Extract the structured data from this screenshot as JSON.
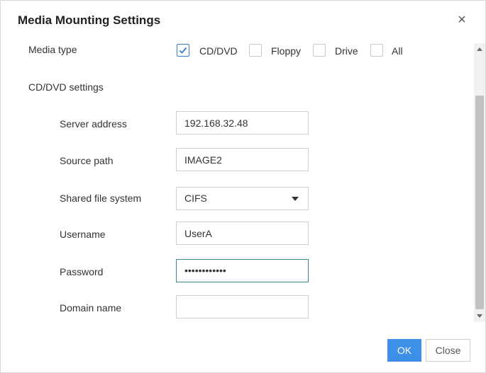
{
  "dialog": {
    "title": "Media Mounting Settings",
    "close_symbol": "×"
  },
  "media_type": {
    "label": "Media type",
    "options": [
      {
        "label": "CD/DVD",
        "checked": true
      },
      {
        "label": "Floppy",
        "checked": false
      },
      {
        "label": "Drive",
        "checked": false
      },
      {
        "label": "All",
        "checked": false
      }
    ]
  },
  "section": {
    "title": "CD/DVD settings"
  },
  "fields": {
    "server_address": {
      "label": "Server address",
      "value": "192.168.32.48"
    },
    "source_path": {
      "label": "Source path",
      "value": "IMAGE2"
    },
    "shared_fs": {
      "label": "Shared file system",
      "value": "CIFS"
    },
    "username": {
      "label": "Username",
      "value": "UserA"
    },
    "password": {
      "label": "Password",
      "value": "••••••••••••"
    },
    "domain": {
      "label": "Domain name",
      "value": ""
    }
  },
  "buttons": {
    "ok": "OK",
    "close": "Close"
  },
  "colors": {
    "accent": "#3d8fe8",
    "check": "#2f7ed8",
    "focus_border": "#3a8a9a"
  }
}
